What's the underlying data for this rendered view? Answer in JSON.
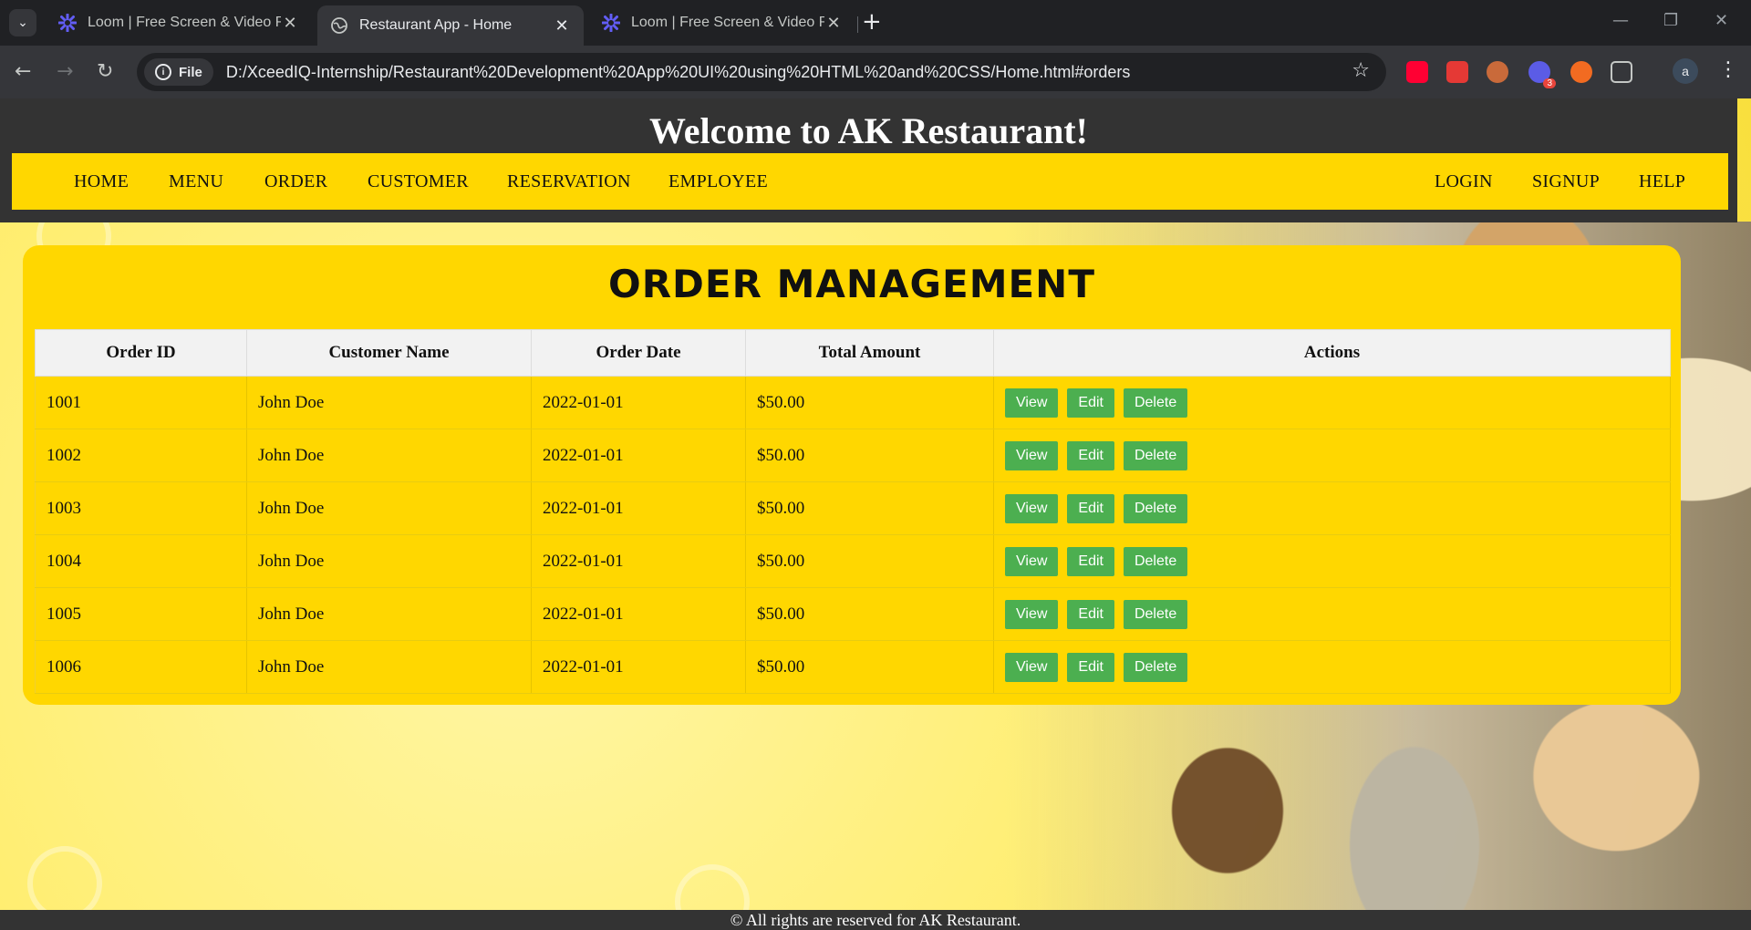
{
  "browser": {
    "tabs": [
      {
        "title": "Loom | Free Screen & Video Recording",
        "icon": "loom-icon",
        "active": false
      },
      {
        "title": "Restaurant App - Home",
        "icon": "globe-icon",
        "active": true
      },
      {
        "title": "Loom | Free Screen & Video Recording",
        "icon": "loom-icon",
        "active": false
      }
    ],
    "file_chip": "File",
    "url": "D:/XceedIQ-Internship/Restaurant%20Development%20App%20UI%20using%20HTML%20and%20CSS/Home.html#orders",
    "profile_initial": "a",
    "extension_badge": "3"
  },
  "site": {
    "title": "Welcome to AK Restaurant!",
    "nav_left": [
      "HOME",
      "MENU",
      "ORDER",
      "CUSTOMER",
      "RESERVATION",
      "EMPLOYEE"
    ],
    "nav_right": [
      "LOGIN",
      "SIGNUP",
      "HELP"
    ],
    "footer": "© All rights are reserved for AK Restaurant."
  },
  "orders": {
    "heading": "ORDER MANAGEMENT",
    "columns": [
      "Order ID",
      "Customer Name",
      "Order Date",
      "Total Amount",
      "Actions"
    ],
    "rows": [
      [
        "1001",
        "John Doe",
        "2022-01-01",
        "$50.00"
      ],
      [
        "1002",
        "John Doe",
        "2022-01-01",
        "$50.00"
      ],
      [
        "1003",
        "John Doe",
        "2022-01-01",
        "$50.00"
      ],
      [
        "1004",
        "John Doe",
        "2022-01-01",
        "$50.00"
      ],
      [
        "1005",
        "John Doe",
        "2022-01-01",
        "$50.00"
      ],
      [
        "1006",
        "John Doe",
        "2022-01-01",
        "$50.00"
      ]
    ],
    "actions": [
      "View",
      "Edit",
      "Delete"
    ]
  },
  "colors": {
    "nav_yellow": "#ffd700",
    "header_dark": "#333333",
    "button_green": "#4caf50"
  }
}
